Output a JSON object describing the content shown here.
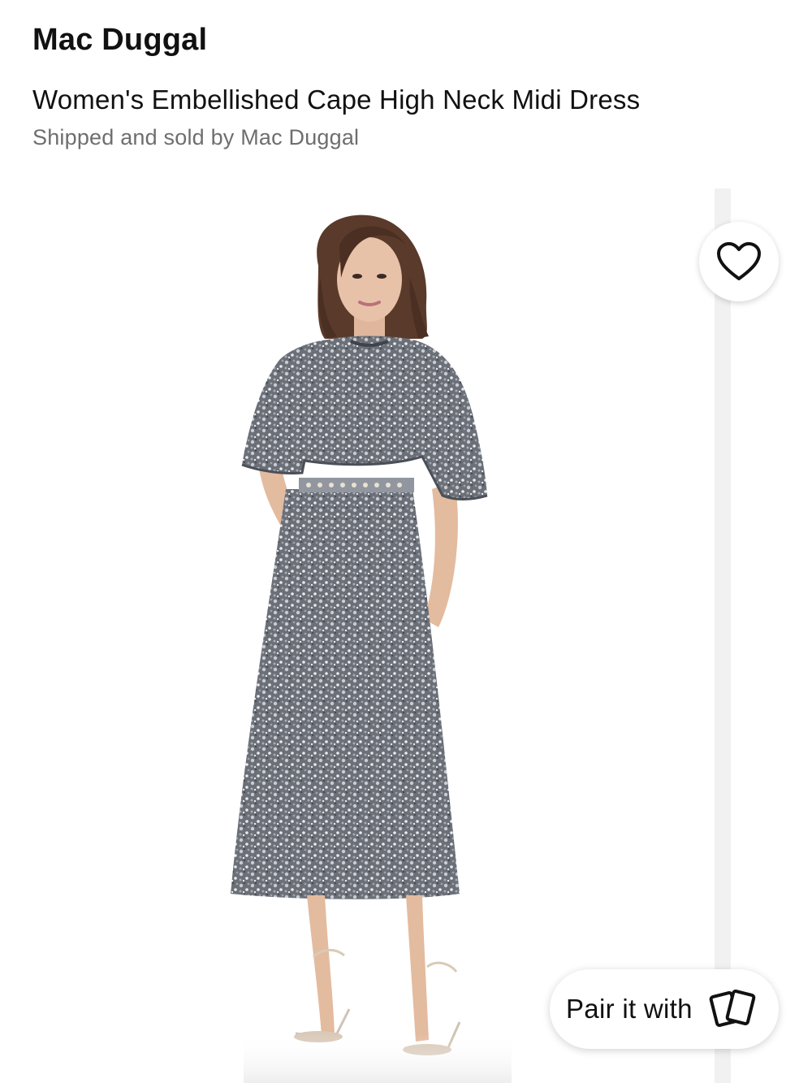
{
  "header": {
    "brand": "Mac Duggal",
    "product_name": "Women's Embellished Cape High Neck Midi Dress",
    "seller_line": "Shipped and sold by Mac Duggal"
  },
  "gallery": {
    "image_alt": "Model wearing a grey sequin cape high neck midi dress with clear strappy heels"
  },
  "actions": {
    "favorite_icon": "heart-outline-icon",
    "pair_label": "Pair it with",
    "pair_icon": "cards-icon"
  },
  "colors": {
    "dress": "#6b6f78",
    "sequin_highlight": "#d8dbe0",
    "hair": "#5a3a2a",
    "skin": "#e7c2a8",
    "secondary_text": "#6e6e6e"
  }
}
